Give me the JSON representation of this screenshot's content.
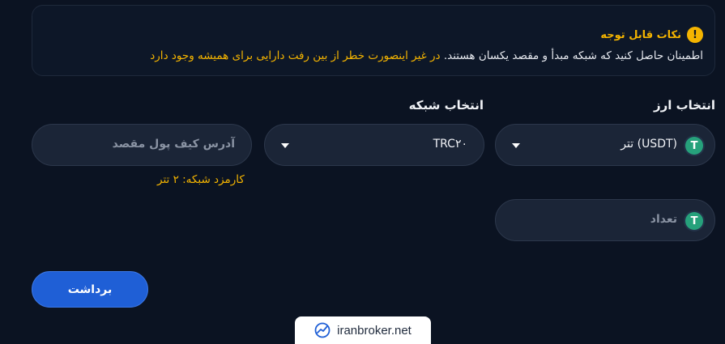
{
  "notice": {
    "title": "نکات قابل توجه",
    "text_plain": "اطمینان حاصل کنید که شبکه مبدأ و مقصد یکسان هستند.",
    "text_warning": "در غیر اینصورت خطر از بین رفت دارایی برای همیشه وجود دارد",
    "icon": "warning-icon",
    "accent": "#f4b400"
  },
  "currency": {
    "label": "انتخاب ارز",
    "selected": "(USDT) تتر",
    "icon": "tether-icon"
  },
  "network": {
    "label": "انتخاب شبکه",
    "selected": "TRC۲۰"
  },
  "address": {
    "placeholder": "آدرس کیف پول مقصد"
  },
  "fee_text": "کارمزد شبکه: ۲ تتر",
  "amount": {
    "placeholder": "تعداد",
    "icon": "tether-icon"
  },
  "withdraw_button": "برداشت",
  "watermark": "iranbroker.net",
  "colors": {
    "background": "#0b1322",
    "field": "#1b2537",
    "button": "#1f5fd6",
    "tether": "#26a17b"
  }
}
